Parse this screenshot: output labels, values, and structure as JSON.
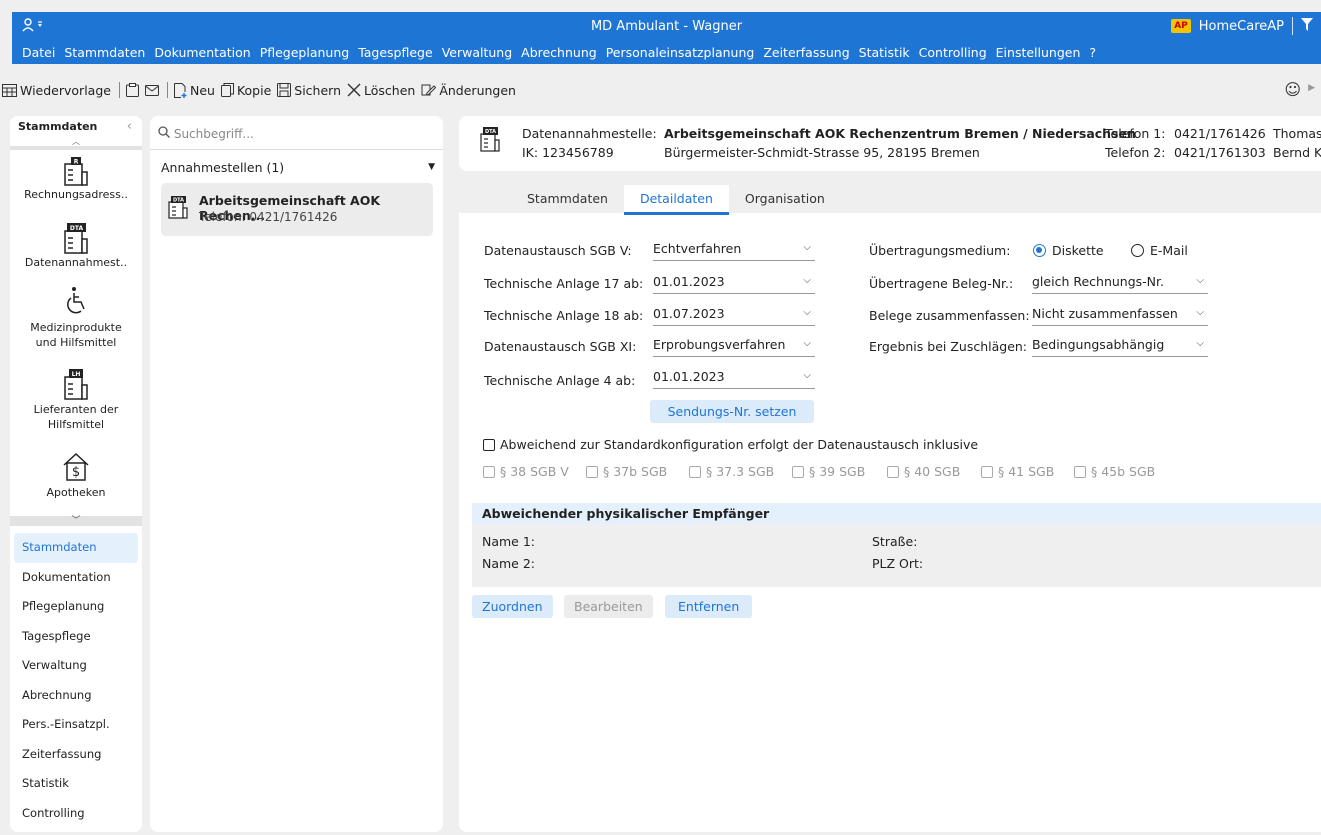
{
  "titlebar": {
    "user_icon": "user-icon",
    "title": "MD Ambulant - Wagner",
    "logo_text": "AP",
    "brand": "HomeCareAP",
    "filter_icon": "filter-icon"
  },
  "menu": [
    "Datei",
    "Stammdaten",
    "Dokumentation",
    "Pflegeplanung",
    "Tagespflege",
    "Verwaltung",
    "Abrechnung",
    "Personaleinsatzplanung",
    "Zeiterfassung",
    "Statistik",
    "Controlling",
    "Einstellungen",
    "?"
  ],
  "toolbar": {
    "wiedervorlage": "Wiedervorlage",
    "neu": "Neu",
    "kopie": "Kopie",
    "sichern": "Sichern",
    "loeschen": "Löschen",
    "aenderungen": "Änderungen"
  },
  "leftnav": {
    "header": "Stammdaten",
    "icon_items": [
      {
        "label": "Rechnungsadress..",
        "badge": "R"
      },
      {
        "label": "Datenannahmest..",
        "badge": "DTA"
      },
      {
        "label": "Medizinprodukte und Hilfsmittel",
        "badge": ""
      },
      {
        "label": "Lieferanten der Hilfsmittel",
        "badge": "LH"
      },
      {
        "label": "Apotheken",
        "badge": ""
      }
    ],
    "modules": [
      "Stammdaten",
      "Dokumentation",
      "Pflegeplanung",
      "Tagespflege",
      "Verwaltung",
      "Abrechnung",
      "Pers.-Einsatzpl.",
      "Zeiterfassung",
      "Statistik",
      "Controlling"
    ]
  },
  "list": {
    "search_placeholder": "Suchbegriff...",
    "group_label": "Annahmestellen (1)",
    "card_name": "Arbeitsgemeinschaft AOK Rechen...",
    "card_phone": "Telefon: 0421/1761426"
  },
  "header": {
    "label_stelle": "Datenannahmestelle:",
    "stelle_name": "Arbeitsgemeinschaft AOK Rechenzentrum Bremen / Niedersachsen",
    "ik": "IK: 123456789",
    "address": "Bürgermeister-Schmidt-Strasse 95, 28195 Bremen",
    "tel1_label": "Telefon 1:",
    "tel1": "0421/1761426",
    "tel1_person": "Thomas",
    "tel2_label": "Telefon 2:",
    "tel2": "0421/1761303",
    "tel2_person": "Bernd K"
  },
  "tabs": [
    "Stammdaten",
    "Detaildaten",
    "Organisation"
  ],
  "detail": {
    "l1": "Datenaustausch SGB V:",
    "v1": "Echtverfahren",
    "l2": "Technische Anlage 17 ab:",
    "v2": "01.01.2023",
    "l3": "Technische Anlage 18 ab:",
    "v3": "01.07.2023",
    "l4": "Datenaustausch SGB XI:",
    "v4": "Erprobungsverfahren",
    "l5": "Technische Anlage 4 ab:",
    "v5": "01.01.2023",
    "sendung_btn": "Sendungs-Nr. setzen",
    "r1": "Übertragungsmedium:",
    "radio1": "Diskette",
    "radio2": "E-Mail",
    "r2": "Übertragene Beleg-Nr.:",
    "rv2": "gleich Rechnungs-Nr.",
    "r3": "Belege zusammenfassen:",
    "rv3": "Nicht zusammenfassen",
    "r4": "Ergebnis bei Zuschlägen:",
    "rv4": "Bedingungsabhängig",
    "abweichend": "Abweichend zur Standardkonfiguration erfolgt der Datenaustausch inklusive",
    "sgb": [
      "§ 38 SGB V",
      "§ 37b SGB",
      "§ 37.3 SGB",
      "§ 39  SGB",
      "§ 40 SGB",
      "§ 41 SGB",
      "§ 45b SGB"
    ],
    "section_title": "Abweichender physikalischer Empfänger",
    "name1": "Name 1:",
    "name2": "Name 2:",
    "strasse": "Straße:",
    "plzort": "PLZ  Ort:",
    "btn_zuordnen": "Zuordnen",
    "btn_bearbeiten": "Bearbeiten",
    "btn_entfernen": "Entfernen"
  }
}
